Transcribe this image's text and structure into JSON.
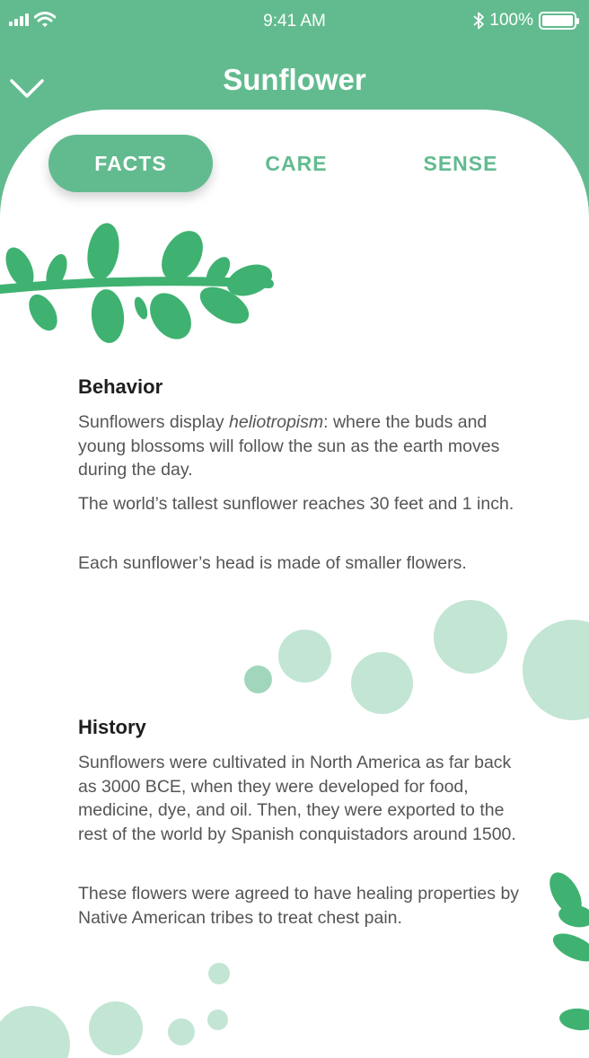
{
  "status_bar": {
    "time": "9:41 AM",
    "battery": "100%"
  },
  "header": {
    "title": "Sunflower"
  },
  "tabs": [
    {
      "label": "FACTS",
      "active": true
    },
    {
      "label": "CARE",
      "active": false
    },
    {
      "label": "SENSE",
      "active": false
    }
  ],
  "sections": {
    "behavior": {
      "title": "Behavior",
      "p1_before": "Sunflowers display ",
      "p1_em": "heliotropism",
      "p1_after": ": where the buds and young blossoms will follow the sun as the earth moves during the day.",
      "p2": "The world’s tallest sunflower reaches 30 feet and 1 inch.",
      "p3": "Each sunflower’s head is made of smaller flowers."
    },
    "history": {
      "title": "History",
      "p1": "Sunflowers were cultivated in North America as far back as 3000 BCE, when they were developed for food, medicine, dye, and oil. Then, they were exported to the rest of the world by Spanish conquistadors around 1500.",
      "p2": "These flowers were agreed to have healing properties by Native American tribes to treat chest pain."
    }
  },
  "colors": {
    "accent": "#62bb8f",
    "leaf": "#3fb271",
    "bubble": "#a8dcc3",
    "heading": "#1e1e1e",
    "body": "#555555"
  },
  "icons": {
    "back": "chevron-down-icon",
    "signal": "cellular-signal-icon",
    "wifi": "wifi-icon",
    "bluetooth": "bluetooth-icon",
    "battery": "battery-icon"
  }
}
